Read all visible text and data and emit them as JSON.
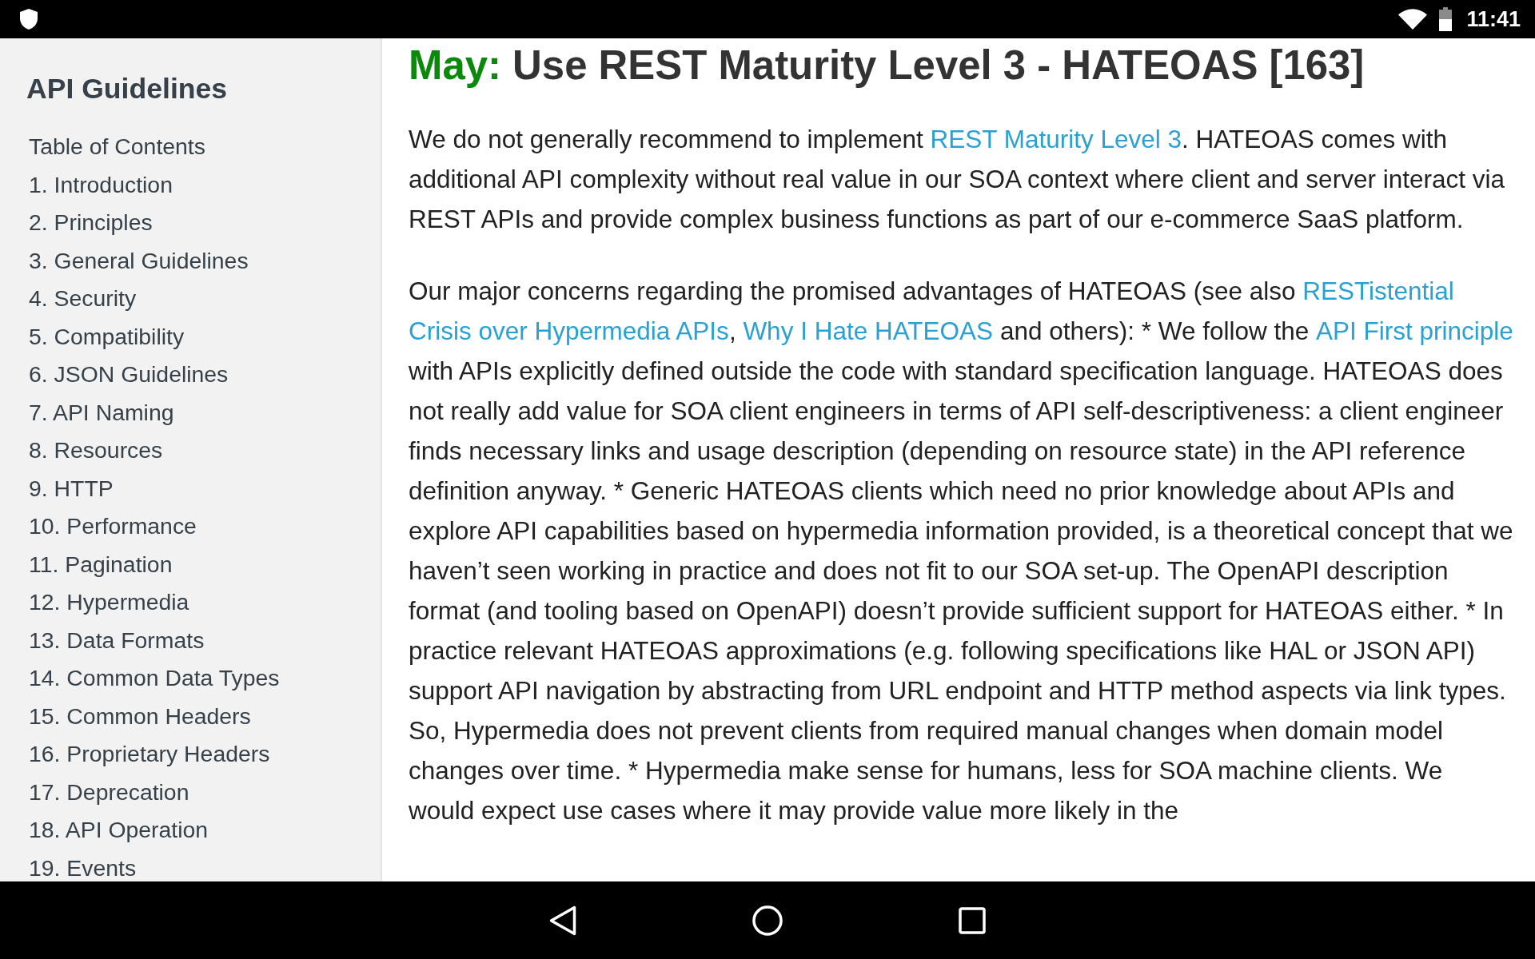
{
  "status_bar": {
    "time": "11:41"
  },
  "sidebar": {
    "title": "API Guidelines",
    "items": [
      {
        "label": "Table of Contents"
      },
      {
        "label": "1. Introduction"
      },
      {
        "label": "2. Principles"
      },
      {
        "label": "3. General Guidelines"
      },
      {
        "label": "4. Security"
      },
      {
        "label": "5. Compatibility"
      },
      {
        "label": "6. JSON Guidelines"
      },
      {
        "label": "7. API Naming"
      },
      {
        "label": "8. Resources"
      },
      {
        "label": "9. HTTP"
      },
      {
        "label": "10. Performance"
      },
      {
        "label": "11. Pagination"
      },
      {
        "label": "12. Hypermedia"
      },
      {
        "label": "13. Data Formats"
      },
      {
        "label": "14. Common Data Types"
      },
      {
        "label": "15. Common Headers"
      },
      {
        "label": "16. Proprietary Headers"
      },
      {
        "label": "17. Deprecation"
      },
      {
        "label": "18. API Operation"
      },
      {
        "label": "19. Events"
      }
    ]
  },
  "article": {
    "heading": {
      "keyword": "May:",
      "title": "Use REST Maturity Level 3 - HATEOAS [163]"
    },
    "paragraphs": [
      [
        {
          "kind": "text",
          "text": "We do not generally recommend to implement "
        },
        {
          "kind": "link",
          "text": "REST Maturity Level 3"
        },
        {
          "kind": "text",
          "text": ". HATEOAS comes with additional API complexity without real value in our SOA context where client and server interact via REST APIs and provide complex business functions as part of our e-commerce SaaS platform."
        }
      ],
      [
        {
          "kind": "text",
          "text": "Our major concerns regarding the promised advantages of HATEOAS (see also "
        },
        {
          "kind": "link",
          "text": "RESTistential "
        },
        {
          "kind": "link",
          "text": "Crisis over Hypermedia APIs"
        },
        {
          "kind": "text",
          "text": ", "
        },
        {
          "kind": "link",
          "text": "Why I Hate HATEOAS"
        },
        {
          "kind": "text",
          "text": " and others): * We follow the "
        },
        {
          "kind": "link",
          "text": "API First principle"
        },
        {
          "kind": "text",
          "text": " with APIs explicitly defined outside the code with standard specification language. HATEOAS does not really add value for SOA client engineers in terms of API self-descriptiveness: a client engineer finds necessary links and usage description (depending on resource state) in the API reference definition anyway. * Generic HATEOAS clients which need no prior knowledge about APIs and explore API capabilities based on hypermedia information provided, is a theoretical concept that we haven’t seen working in practice and does not fit to our SOA set-up. The OpenAPI description format (and tooling based on OpenAPI) doesn’t provide sufficient support for HATEOAS either. * In practice relevant HATEOAS approximations (e.g. following specifications like HAL or JSON API) support API navigation by abstracting from URL endpoint and HTTP method aspects via link types. So, Hypermedia does not prevent clients from required manual changes when domain model changes over time. * Hypermedia make sense for humans, less for SOA machine clients. We would expect use cases where it may provide value more likely in the"
        }
      ]
    ]
  }
}
